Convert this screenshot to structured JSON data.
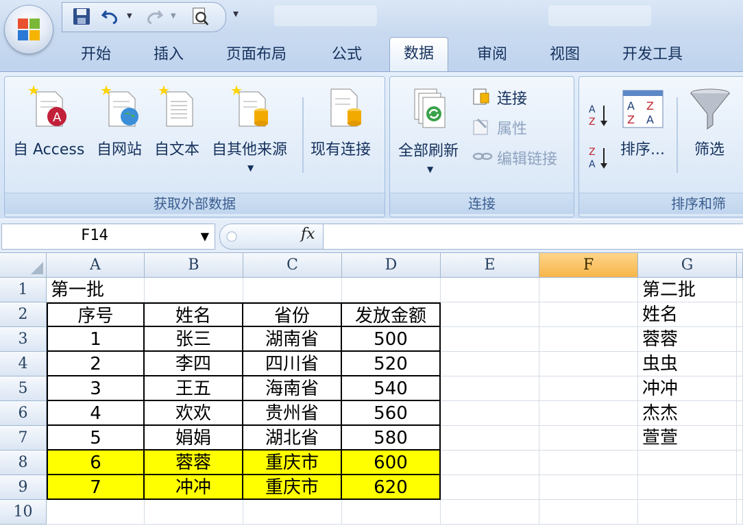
{
  "ribbon_tabs": [
    "开始",
    "插入",
    "页面布局",
    "公式",
    "数据",
    "审阅",
    "视图",
    "开发工具"
  ],
  "active_tab": "数据",
  "groups": {
    "external": {
      "label": "获取外部数据",
      "buttons": [
        "自 Access",
        "自网站",
        "自文本",
        "自其他来源",
        "现有连接"
      ]
    },
    "connections": {
      "label": "连接",
      "refresh_all": "全部刷新",
      "connections": "连接",
      "properties": "属性",
      "edit_links": "编辑链接"
    },
    "sort_filter": {
      "label": "排序和筛",
      "sort": "排序...",
      "filter": "筛选",
      "az": "A Z",
      "za": "Z A"
    }
  },
  "formula_bar": {
    "name_box": "F14",
    "fx": "fx",
    "formula": ""
  },
  "columns": [
    "A",
    "B",
    "C",
    "D",
    "E",
    "F",
    "G"
  ],
  "selected_column": "F",
  "rows": [
    "1",
    "2",
    "3",
    "4",
    "5",
    "6",
    "7",
    "8",
    "9",
    "10"
  ],
  "sheet": {
    "A1": "第一批",
    "header": [
      "序号",
      "姓名",
      "省份",
      "发放金额"
    ],
    "table": [
      [
        "1",
        "张三",
        "湖南省",
        "500"
      ],
      [
        "2",
        "李四",
        "四川省",
        "520"
      ],
      [
        "3",
        "王五",
        "海南省",
        "540"
      ],
      [
        "4",
        "欢欢",
        "贵州省",
        "560"
      ],
      [
        "5",
        "娟娟",
        "湖北省",
        "580"
      ],
      [
        "6",
        "蓉蓉",
        "重庆市",
        "600"
      ],
      [
        "7",
        "冲冲",
        "重庆市",
        "620"
      ]
    ],
    "highlight_color": "#ffff00",
    "G_column": [
      "第二批",
      "姓名",
      "蓉蓉",
      "虫虫",
      "冲冲",
      "杰杰",
      "萱萱"
    ]
  }
}
